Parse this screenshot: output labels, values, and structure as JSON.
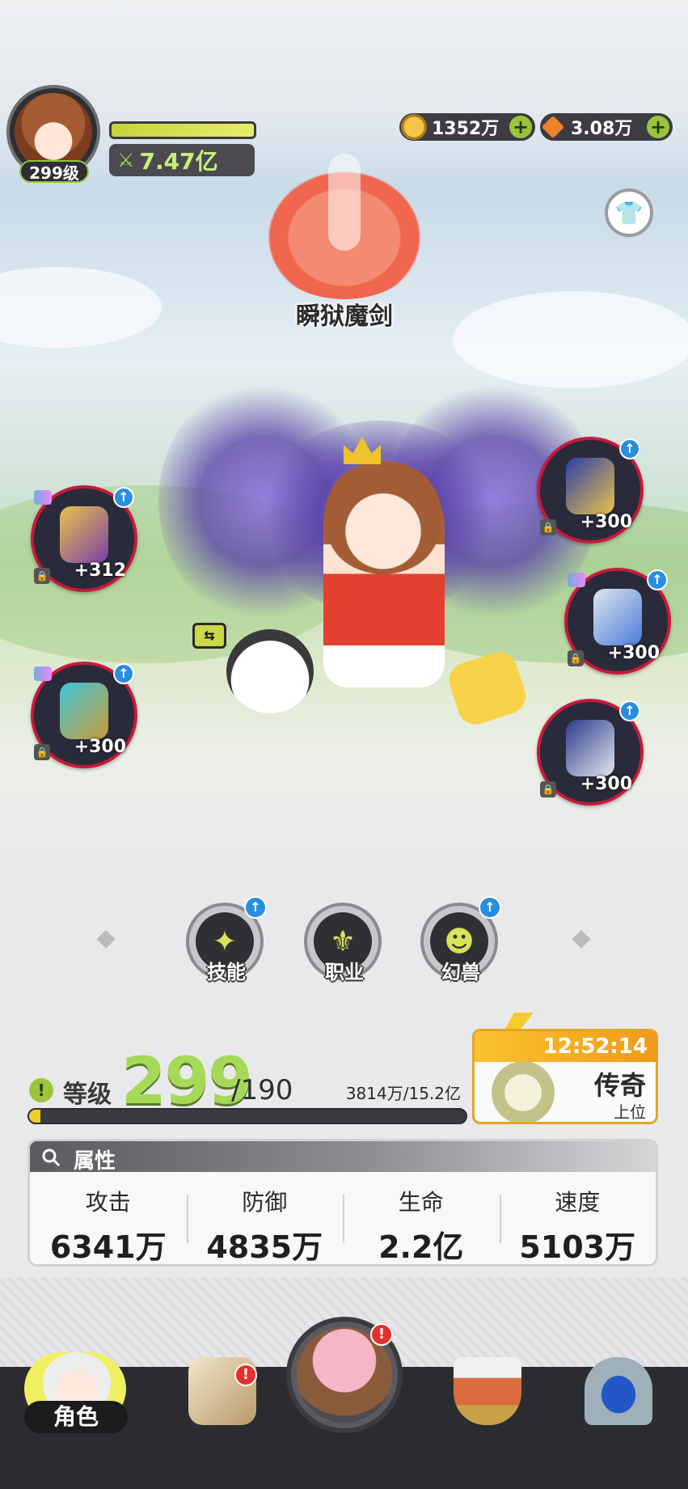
{
  "player": {
    "level_badge": "299级",
    "power": "7.47亿"
  },
  "currencies": {
    "gold": "1352万",
    "gems": "3.08万"
  },
  "class": {
    "name": "瞬狱魔剑"
  },
  "equipment": {
    "left": [
      {
        "bonus": "+312"
      },
      {
        "bonus": "+300"
      }
    ],
    "right": [
      {
        "bonus": "+300"
      },
      {
        "bonus": "+300"
      },
      {
        "bonus": "+300"
      }
    ]
  },
  "features": [
    {
      "label": "技能",
      "icon": "skill-icon"
    },
    {
      "label": "职业",
      "icon": "class-icon"
    },
    {
      "label": "幻兽",
      "icon": "beast-icon"
    }
  ],
  "level": {
    "label": "等级",
    "value": "299",
    "max": "/190",
    "exp": "3814万/15.2亿",
    "exp_fraction": 0.025
  },
  "rank": {
    "timer": "12:52:14",
    "name": "传奇",
    "sub": "上位"
  },
  "attributes": {
    "title": "属性",
    "items": [
      {
        "name": "攻击",
        "value": "6341万"
      },
      {
        "name": "防御",
        "value": "4835万"
      },
      {
        "name": "生命",
        "value": "2.2亿"
      },
      {
        "name": "速度",
        "value": "5103万"
      }
    ]
  },
  "nav": {
    "role_label": "角色",
    "alert": "!"
  },
  "colors": {
    "accent_green": "#a6d957",
    "equip_ring": "#c8193b",
    "rank_gold": "#f29a1a",
    "alert_red": "#e5302c"
  }
}
